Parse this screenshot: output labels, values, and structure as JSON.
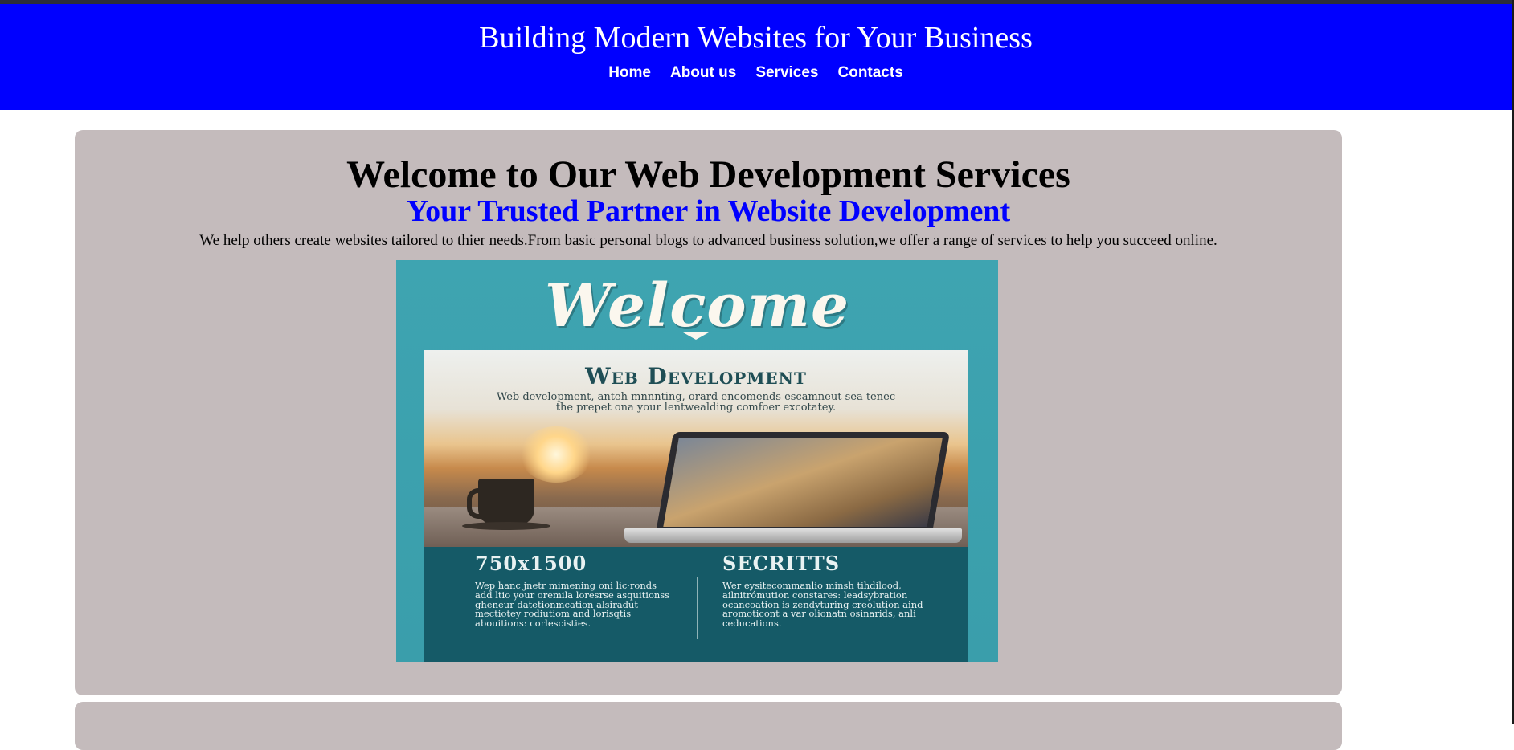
{
  "header": {
    "title": "Building Modern Websites for Your Business",
    "nav": [
      "Home",
      "About us",
      "Services",
      "Contacts"
    ]
  },
  "hero": {
    "heading": "Welcome to Our Web Development Services",
    "subheading": "Your Trusted Partner in Website Development",
    "intro": "We help others create websites tailored to thier needs.From basic personal blogs to advanced business solution,we offer a range of services to help you succeed online."
  },
  "poster": {
    "welcome": "Welcome",
    "photo_heading": "Web Development",
    "photo_text": "Web development, anteh mnnnting, orard encomends escamneut sea tenec the prepet ona your lentwealding comfoer excotatey.",
    "left_heading": "750x1500",
    "left_text": "Wep hanc jnetr mimening oni lic·ronds add ltio your oremila loresrse asquitionss gheneur datetionmcation alsiradut mectiotey rodiutiom and lorisqtis abouitions: corlescisties.",
    "right_heading": "SECRITTS",
    "right_text": "Wer eysitecommanlio minsh tihdilood, ailnitrómution constares: leadsybration ocancoation is zendvturing creolution aind aromoticont a var olionatn osinarids, anli ceducations."
  },
  "colors": {
    "header_bg": "#0000ff",
    "card_bg": "#c4bbbc",
    "subheading": "#0000ff"
  }
}
